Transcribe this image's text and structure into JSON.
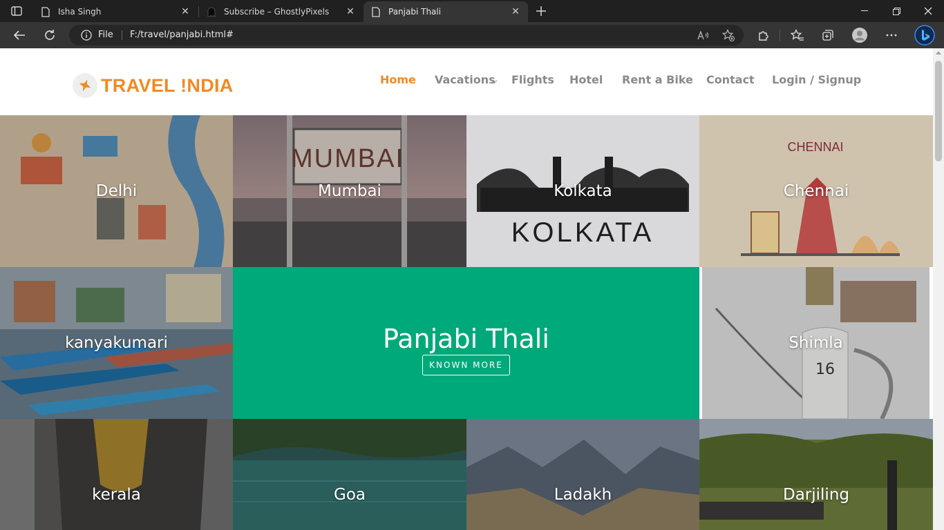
{
  "browser": {
    "tabs": [
      {
        "title": "Isha Singh",
        "icon": "page-icon"
      },
      {
        "title": "Subscribe – GhostlyPixels",
        "icon": "ghost-icon"
      },
      {
        "title": "Panjabi Thali",
        "icon": "page-icon",
        "active": true
      }
    ],
    "omnibox": {
      "scheme_label": "File",
      "url": "F:/travel/panjabi.html#"
    },
    "colors": {
      "chrome_dark": "#202020",
      "toolbar": "#353535",
      "omnibox": "#262626"
    }
  },
  "site": {
    "logo_text": "TRAVEL !NDIA",
    "accent_color": "#f08a24",
    "nav": [
      {
        "label": "Home",
        "active": true
      },
      {
        "label": "Vacations",
        "dropdown": true
      },
      {
        "label": "Flights"
      },
      {
        "label": "Hotel"
      },
      {
        "label": "Rent a Bike"
      },
      {
        "label": "Contact"
      },
      {
        "label": "Login / Signup"
      }
    ]
  },
  "tiles": [
    {
      "label": "Delhi",
      "color": "#b9a891"
    },
    {
      "label": "Mumbai",
      "color": "#6f5f5e"
    },
    {
      "label": "Kolkata",
      "color": "#d6d5d8"
    },
    {
      "label": "Chennai",
      "color": "#cfc3ae"
    },
    {
      "label": "kanyakumari",
      "color": "#5d7690"
    },
    {
      "label": "Shimla",
      "color": "#9a9893"
    },
    {
      "label": "kerala",
      "color": "#4a4646"
    },
    {
      "label": "Goa",
      "color": "#2f5b59"
    },
    {
      "label": "Ladakh",
      "color": "#4d5968"
    },
    {
      "label": "Darjiling",
      "color": "#52612e"
    }
  ],
  "feature": {
    "title": "Panjabi Thali",
    "button_label": "KNOWN MORE",
    "color": "#00a97a"
  }
}
